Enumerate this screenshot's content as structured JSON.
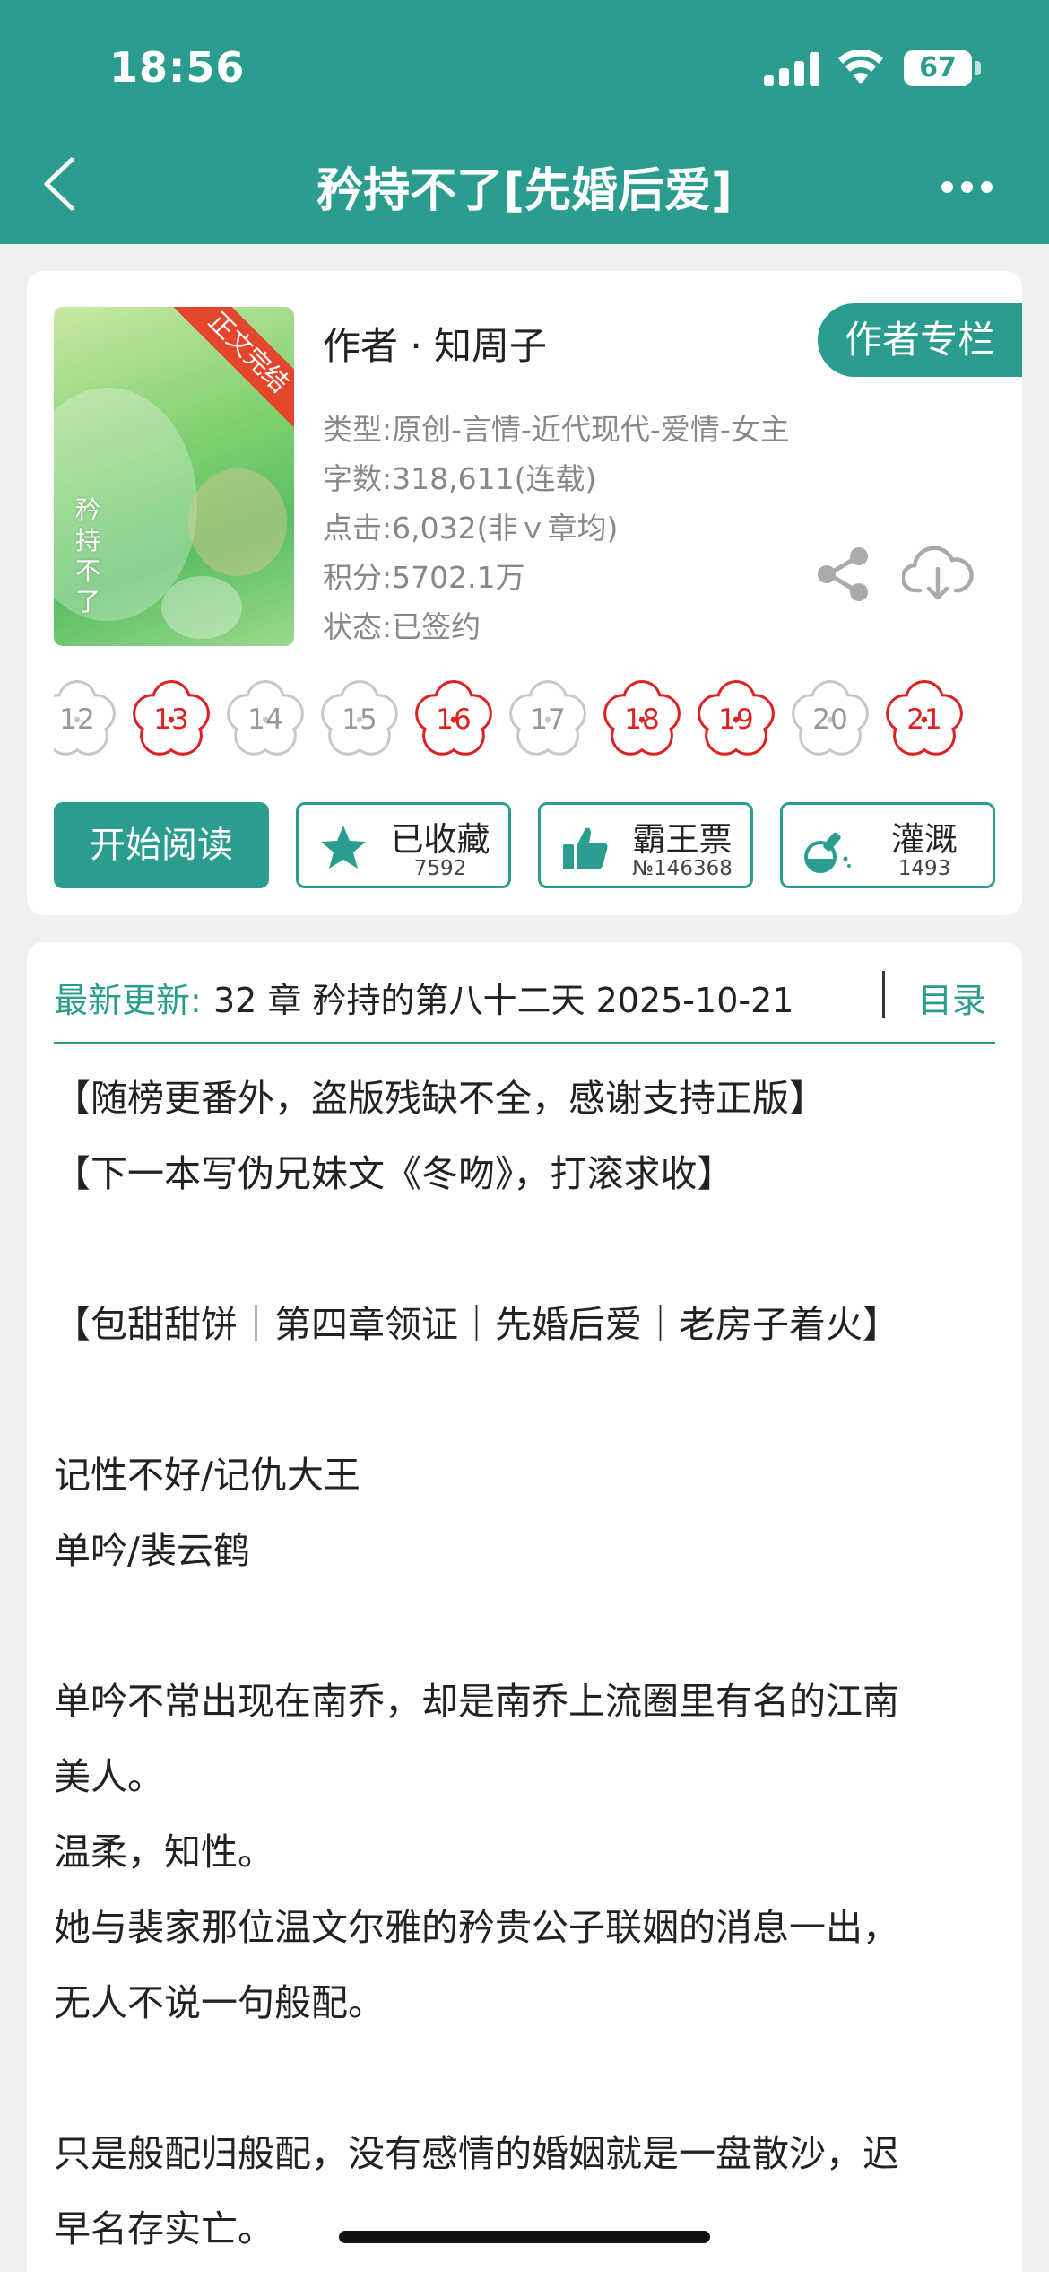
{
  "status_bar": {
    "time": "18:56",
    "battery": "67"
  },
  "nav": {
    "title": "矜持不了[先婚后爱]"
  },
  "book": {
    "cover": {
      "ribbon": "正文完结",
      "title": "矜持不了"
    },
    "author": "作者 · 知周子",
    "author_button": "作者专栏",
    "meta": [
      "类型:原创-言情-近代现代-爱情-女主",
      "字数:318,611(连载)",
      "点击:6,032(非ｖ章均)",
      "积分:5702.1万",
      "状态:已签约"
    ]
  },
  "flowers": [
    {
      "num": "12",
      "active": false
    },
    {
      "num": "13",
      "active": true
    },
    {
      "num": "14",
      "active": false
    },
    {
      "num": "15",
      "active": false
    },
    {
      "num": "16",
      "active": true
    },
    {
      "num": "17",
      "active": false
    },
    {
      "num": "18",
      "active": true
    },
    {
      "num": "19",
      "active": true
    },
    {
      "num": "20",
      "active": false
    },
    {
      "num": "21",
      "active": true
    }
  ],
  "actions": {
    "read": "开始阅读",
    "collect": {
      "label": "已收藏",
      "count": "7592"
    },
    "vote": {
      "label": "霸王票",
      "count": "№146368"
    },
    "water": {
      "label": "灌溉",
      "count": "1493"
    }
  },
  "update": {
    "label": "最新更新:",
    "text": "32 章 矜持的第八十二天 2025-10-21",
    "toc": "目录"
  },
  "content": [
    "【随榜更番外，盗版残缺不全，感谢支持正版】",
    "【下一本写伪兄妹文《冬吻》，打滚求收】",
    "【包甜甜饼｜第四章领证｜先婚后爱｜老房子着火】",
    "记性不好/记仇大王",
    "单吟/裴云鹤",
    "单吟不常出现在南乔，却是南乔上流圈里有名的江南",
    "美人。",
    "温柔，知性。",
    "她与裴家那位温文尔雅的矜贵公子联姻的消息一出，",
    "无人不说一句般配。",
    "只是般配归般配，没有感情的婚姻就是一盘散沙，迟",
    "早名存实亡。"
  ],
  "colors": {
    "accent": "#2a9d8f",
    "flower_active": "#e02020",
    "flower_inactive": "#c8c8c8"
  }
}
